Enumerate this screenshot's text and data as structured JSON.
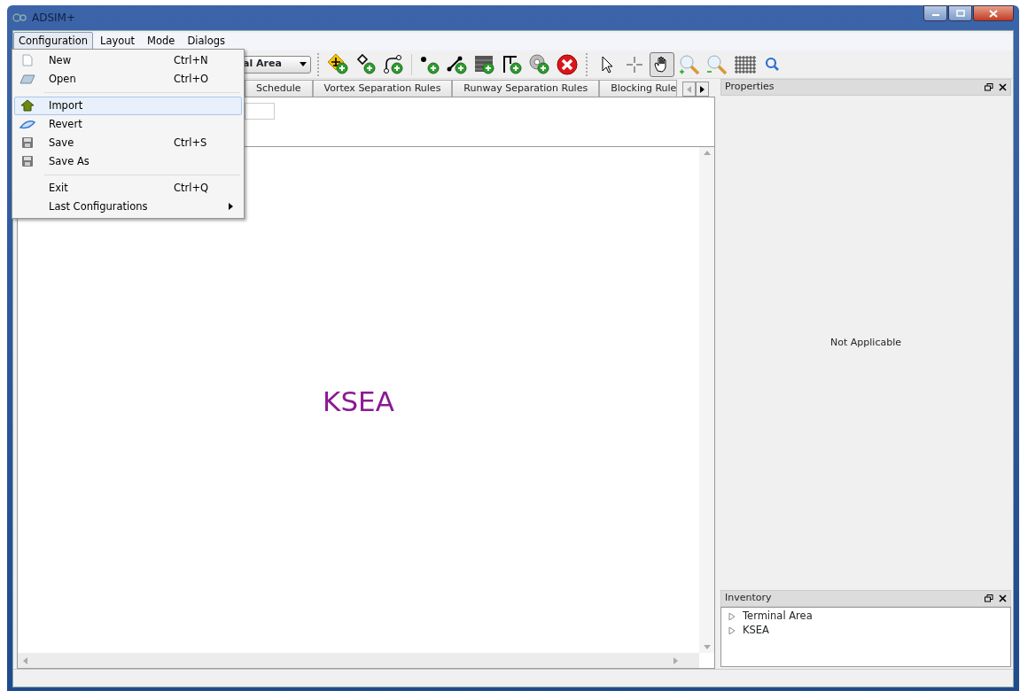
{
  "window": {
    "title": "ADSIM+"
  },
  "menu_bar": [
    {
      "label": "Configuration",
      "selected": true
    },
    {
      "label": "Layout",
      "selected": false
    },
    {
      "label": "Mode",
      "selected": false
    },
    {
      "label": "Dialogs",
      "selected": false
    }
  ],
  "open_menu": {
    "items": [
      {
        "kind": "item",
        "label": "New",
        "shortcut": "Ctrl+N",
        "selected": false,
        "submenu": false
      },
      {
        "kind": "item",
        "label": "Open",
        "shortcut": "Ctrl+O",
        "selected": false,
        "submenu": false
      },
      {
        "kind": "separator"
      },
      {
        "kind": "item",
        "label": "Import",
        "selected": true,
        "submenu": false
      },
      {
        "kind": "item",
        "label": "Revert",
        "selected": false,
        "submenu": false
      },
      {
        "kind": "item",
        "label": "Save",
        "shortcut": "Ctrl+S",
        "selected": false,
        "submenu": false
      },
      {
        "kind": "item",
        "label": "Save As",
        "selected": false,
        "submenu": false
      },
      {
        "kind": "separator"
      },
      {
        "kind": "item",
        "label": "Exit",
        "shortcut": "Ctrl+Q",
        "selected": false,
        "submenu": false
      },
      {
        "kind": "item",
        "label": "Last Configurations",
        "selected": false,
        "submenu": true
      }
    ]
  },
  "toolbar": {
    "combo": {
      "value": "al Area"
    },
    "tool_groups": [
      [
        {
          "selected": false
        },
        {
          "selected": false
        },
        {
          "selected": false
        }
      ],
      [
        {
          "selected": false
        },
        {
          "selected": false
        },
        {
          "selected": false
        },
        {
          "selected": false
        },
        {
          "selected": false
        },
        {
          "selected": false
        }
      ],
      [
        {
          "selected": false
        },
        {
          "selected": false
        },
        {
          "selected": true
        },
        {
          "selected": false
        },
        {
          "selected": false
        },
        {
          "selected": false
        },
        {
          "selected": false
        }
      ]
    ]
  },
  "tabs": [
    {
      "label": "Schedule",
      "selected": false
    },
    {
      "label": "Vortex Separation Rules",
      "selected": false
    },
    {
      "label": "Runway Separation Rules",
      "selected": false
    },
    {
      "label": "Blocking Rule",
      "selected": false
    }
  ],
  "canvas": {
    "label": "KSEA"
  },
  "properties": {
    "title": "Properties",
    "message": "Not Applicable"
  },
  "inventory": {
    "title": "Inventory",
    "items": [
      {
        "label": "Terminal Area",
        "expanded": false
      },
      {
        "label": "KSEA",
        "expanded": false
      }
    ]
  }
}
